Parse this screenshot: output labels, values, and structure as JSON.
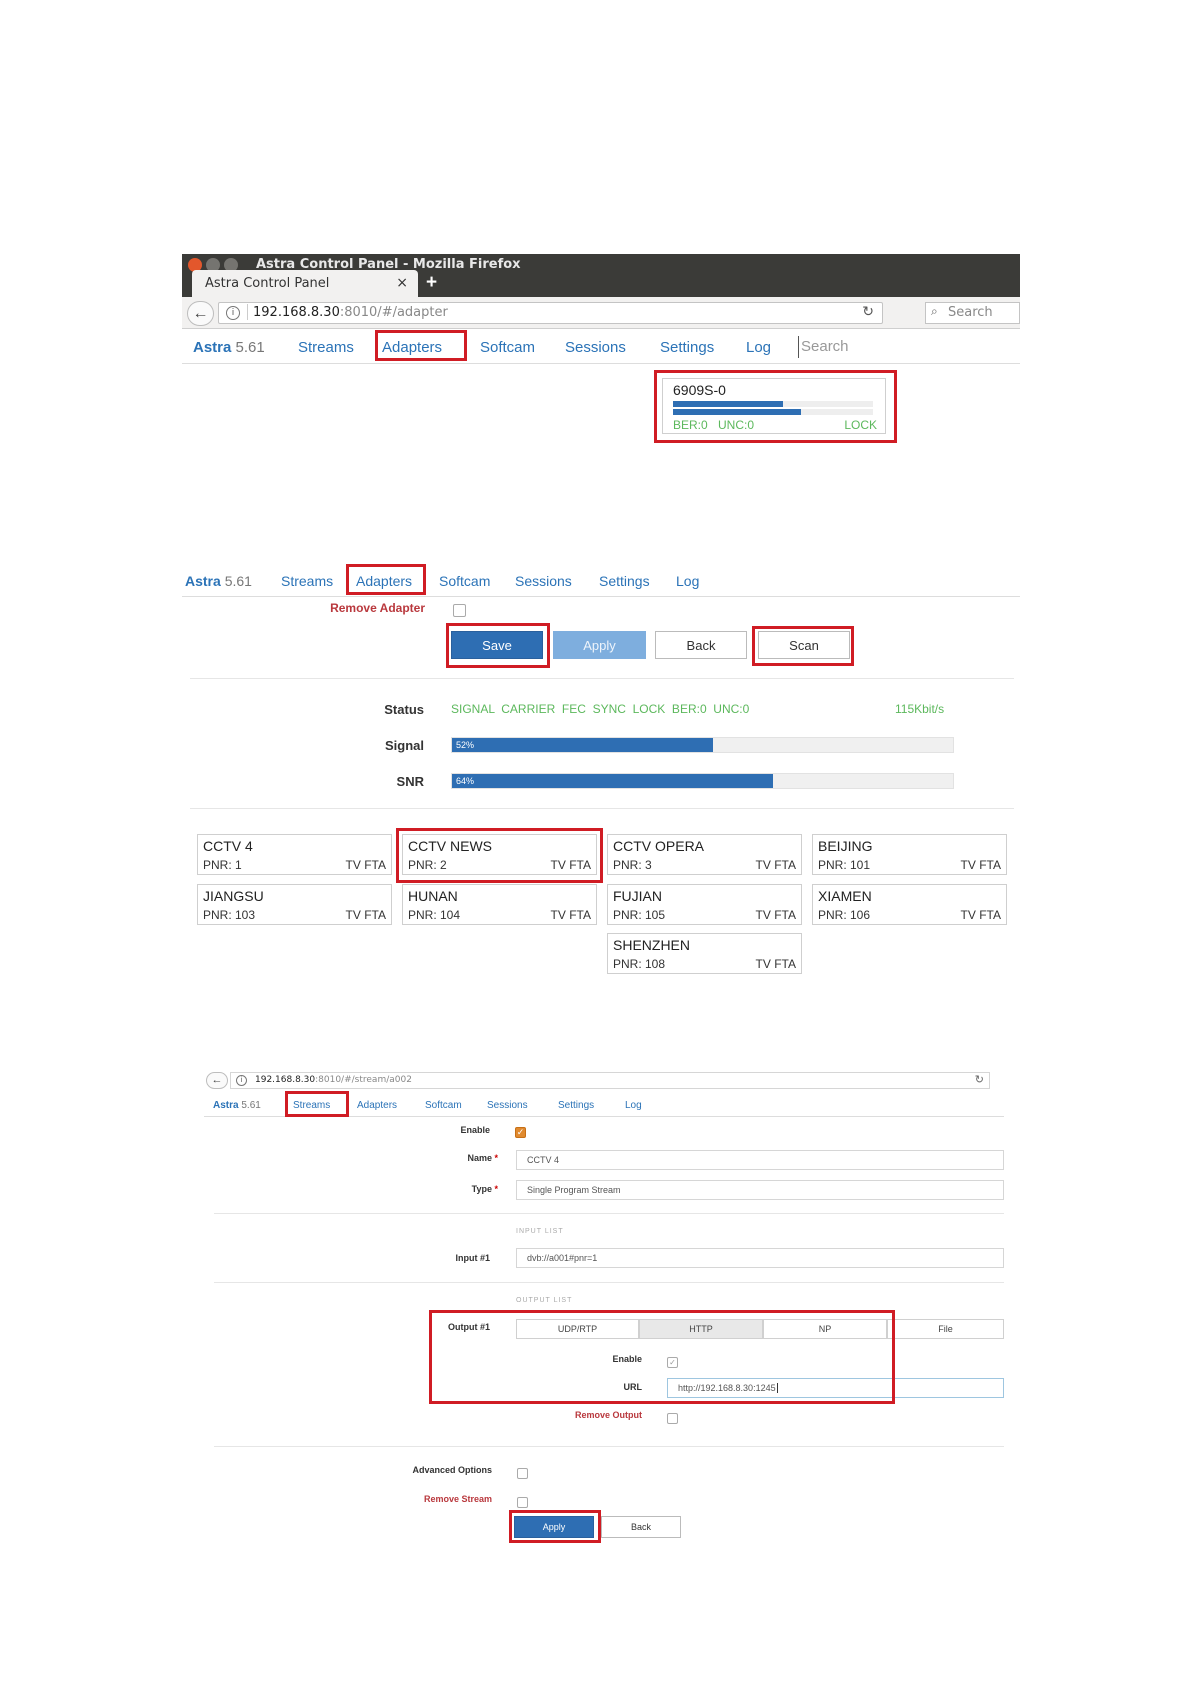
{
  "window": {
    "title": "Astra Control Panel - Mozilla Firefox",
    "tab_title": "Astra Control Panel",
    "tab_close": "×",
    "new_tab": "+",
    "url_host": "192.168.8.30",
    "url_rest": ":8010/#/adapter",
    "search_placeholder": "Search"
  },
  "nav1": {
    "brand": "Astra",
    "version": "5.61",
    "items": [
      "Streams",
      "Adapters",
      "Softcam",
      "Sessions",
      "Settings",
      "Log"
    ],
    "search_placeholder": "Search"
  },
  "adapter_card": {
    "name": "6909S-0",
    "signal_level": 0.55,
    "snr_level": 0.64,
    "ber": "BER:0",
    "unc": "UNC:0",
    "lock": "LOCK"
  },
  "nav2": {
    "brand": "Astra",
    "version": "5.61",
    "items": [
      "Streams",
      "Adapters",
      "Softcam",
      "Sessions",
      "Settings",
      "Log"
    ]
  },
  "adapter_form": {
    "remove_adapter_label": "Remove Adapter",
    "buttons": {
      "save": "Save",
      "apply": "Apply",
      "back": "Back",
      "scan": "Scan"
    },
    "status_label": "Status",
    "status_flags": "SIGNAL  CARRIER  FEC  SYNC  LOCK  BER:0  UNC:0",
    "bitrate": "115Kbit/s",
    "signal_label": "Signal",
    "signal_pct": "52%",
    "signal_value": 0.52,
    "snr_label": "SNR",
    "snr_pct": "64%",
    "snr_value": 0.64
  },
  "channels": [
    {
      "name": "CCTV 4",
      "pnr": "PNR: 1",
      "type": "TV FTA"
    },
    {
      "name": "CCTV NEWS",
      "pnr": "PNR: 2",
      "type": "TV FTA"
    },
    {
      "name": "CCTV OPERA",
      "pnr": "PNR: 3",
      "type": "TV FTA"
    },
    {
      "name": "BEIJING",
      "pnr": "PNR: 101",
      "type": "TV FTA"
    },
    {
      "name": "JIANGSU",
      "pnr": "PNR: 103",
      "type": "TV FTA"
    },
    {
      "name": "HUNAN",
      "pnr": "PNR: 104",
      "type": "TV FTA"
    },
    {
      "name": "FUJIAN",
      "pnr": "PNR: 105",
      "type": "TV FTA"
    },
    {
      "name": "XIAMEN",
      "pnr": "PNR: 106",
      "type": "TV FTA"
    },
    {
      "name": "SHENZHEN",
      "pnr": "PNR: 108",
      "type": "TV FTA"
    }
  ],
  "stream_page": {
    "url_host": "192.168.8.30",
    "url_rest": ":8010/#/stream/a002",
    "nav": {
      "brand": "Astra",
      "version": "5.61",
      "items": [
        "Streams",
        "Adapters",
        "Softcam",
        "Sessions",
        "Settings",
        "Log"
      ]
    },
    "enable_label": "Enable",
    "name_label": "Name",
    "name_value": "CCTV 4",
    "type_label": "Type",
    "type_value": "Single Program Stream",
    "required_mark": "*",
    "input_list_title": "INPUT LIST",
    "input1_label": "Input #1",
    "input1_value": "dvb://a001#pnr=1",
    "output_list_title": "OUTPUT LIST",
    "output1_label": "Output #1",
    "output_tabs": [
      "UDP/RTP",
      "HTTP",
      "NP",
      "File"
    ],
    "output_enable_label": "Enable",
    "url_label": "URL",
    "url_value": "http://192.168.8.30:1245",
    "remove_output_label": "Remove Output",
    "advanced_options_label": "Advanced Options",
    "remove_stream_label": "Remove Stream",
    "apply_button": "Apply",
    "back_button": "Back"
  },
  "colors": {
    "accent": "#2e6eb3",
    "status_green": "#5cb85c",
    "highlight_red": "#d01c24",
    "danger_text": "#b9383d"
  }
}
